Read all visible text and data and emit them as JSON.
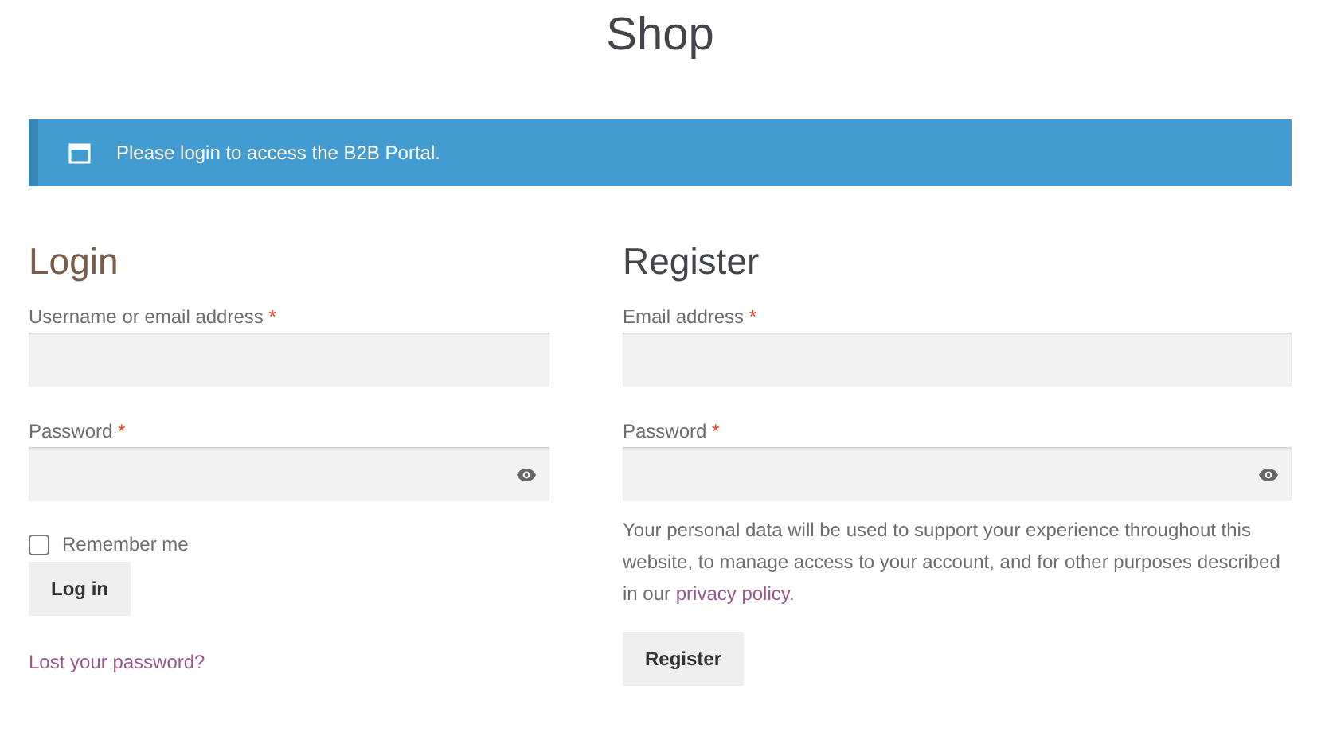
{
  "page_title": "Shop",
  "notice": {
    "text": "Please login to access the B2B Portal."
  },
  "login": {
    "heading": "Login",
    "fields": [
      {
        "label": "Username or email address",
        "required_mark": "*",
        "kind": "text"
      },
      {
        "label": "Password",
        "required_mark": "*",
        "kind": "password"
      }
    ],
    "remember": {
      "label": "Remember me",
      "checked": false
    },
    "button": "Log in",
    "lost_password": "Lost your password?"
  },
  "register": {
    "heading": "Register",
    "fields": [
      {
        "label": "Email address",
        "required_mark": "*",
        "kind": "text"
      },
      {
        "label": "Password",
        "required_mark": "*",
        "kind": "password"
      }
    ],
    "privacy_text": {
      "before": "Your personal data will be used to support your experience throughout this website, to manage access to your account, and for other purposes described in our ",
      "link": "privacy policy",
      "after": "."
    },
    "button": "Register"
  }
}
